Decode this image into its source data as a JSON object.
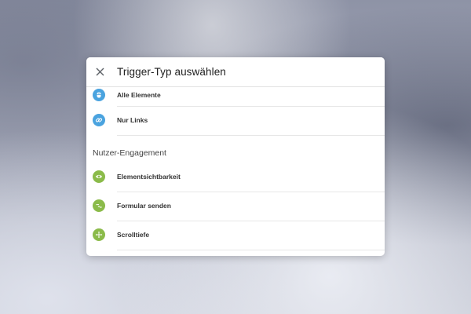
{
  "dialog": {
    "title": "Trigger-Typ auswählen",
    "close_icon": "close-icon"
  },
  "groups": [
    {
      "items": [
        {
          "label": "Alle Elemente",
          "icon": "cursor-click-icon",
          "color": "#4aa3df"
        },
        {
          "label": "Nur Links",
          "icon": "link-icon",
          "color": "#4aa3df"
        }
      ]
    },
    {
      "title": "Nutzer-Engagement",
      "items": [
        {
          "label": "Elementsichtbarkeit",
          "icon": "eye-icon",
          "color": "#8bbb4a"
        },
        {
          "label": "Formular senden",
          "icon": "form-icon",
          "color": "#8bbb4a"
        },
        {
          "label": "Scrolltiefe",
          "icon": "move-arrows-icon",
          "color": "#8bbb4a"
        }
      ]
    }
  ]
}
